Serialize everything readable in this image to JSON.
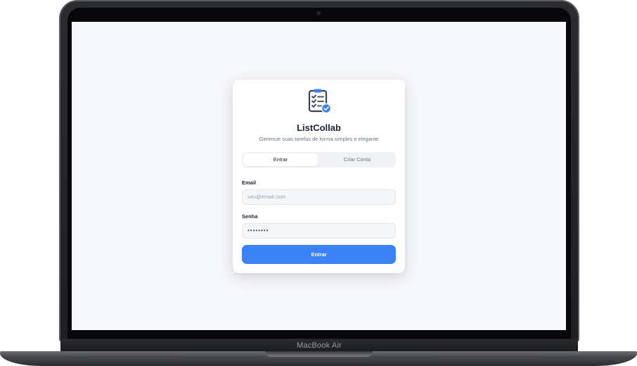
{
  "device": {
    "label": "MacBook Air"
  },
  "app": {
    "name": "ListCollab",
    "tagline": "Gerencie suas tarefas de forma simples e elegante",
    "brand_color": "#3b82f6"
  },
  "tabs": [
    {
      "label": "Entrar",
      "active": true
    },
    {
      "label": "Criar Conta",
      "active": false
    }
  ],
  "form": {
    "email_label": "Email",
    "email_placeholder": "seu@email.com",
    "password_label": "Senha",
    "password_value": "••••••••",
    "submit_label": "Entrar"
  },
  "icons": {
    "logo": "clipboard-checklist-icon",
    "badge": "check-badge-icon"
  }
}
